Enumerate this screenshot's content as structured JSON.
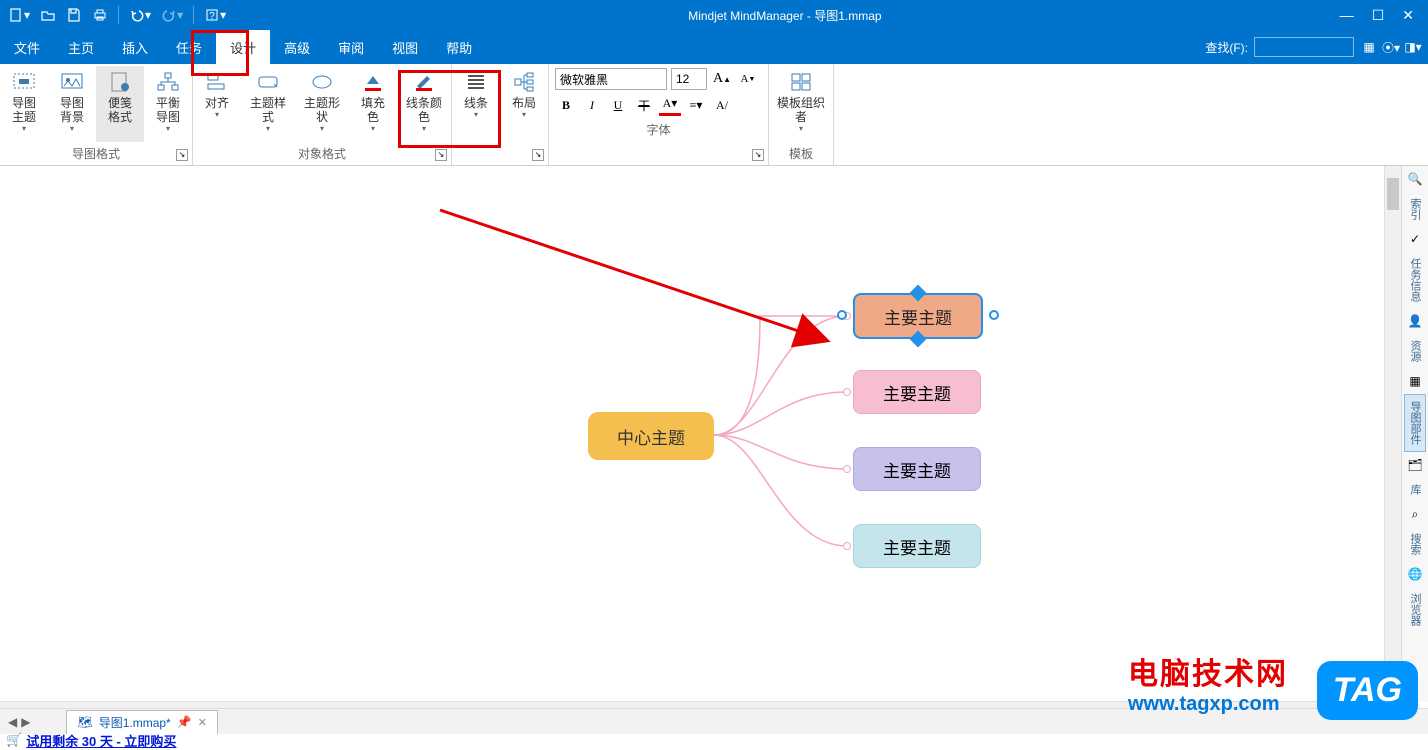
{
  "app_title": "Mindjet MindManager - 导图1.mmap",
  "qat": [
    "new",
    "open",
    "save",
    "print",
    "undo",
    "redo",
    "help"
  ],
  "menus": {
    "items": [
      "文件",
      "主页",
      "插入",
      "任务",
      "设计",
      "高级",
      "审阅",
      "视图",
      "帮助"
    ],
    "active_index": 4,
    "search_label": "查找(F):"
  },
  "ribbon": {
    "group_map_format": {
      "label": "导图格式",
      "btn_theme": "导图主题",
      "btn_bg": "导图背景",
      "btn_note": "便笺格式",
      "btn_balance": "平衡导图"
    },
    "group_obj_format": {
      "label": "对象格式",
      "btn_align": "对齐",
      "btn_style": "主题样式",
      "btn_shape": "主题形状",
      "btn_fill": "填充色",
      "btn_line": "线条颜色"
    },
    "group_layout": {
      "label": "",
      "btn_lines": "线条",
      "btn_layout": "布局"
    },
    "group_font": {
      "label": "字体",
      "font_name": "微软雅黑",
      "font_size": "12"
    },
    "group_template": {
      "label": "模板",
      "btn_org": "模板组织者"
    }
  },
  "side_panels": [
    "索引",
    "任务信息",
    "资源",
    "导图部件",
    "库",
    "搜索",
    "浏览器"
  ],
  "mindmap": {
    "center": "中心主题",
    "topic1": "主要主题",
    "topic2": "主要主题",
    "topic3": "主要主题",
    "topic4": "主要主题"
  },
  "doc_tab": {
    "name": "导图1.mmap*"
  },
  "status_text": "试用剩余 30 天 - 立即购买",
  "watermark": {
    "line1": "电脑技术网",
    "line2": "www.tagxp.com",
    "tag": "TAG"
  }
}
